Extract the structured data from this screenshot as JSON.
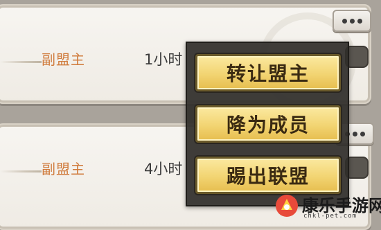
{
  "members": [
    {
      "role": "副盟主",
      "time": "1小时"
    },
    {
      "role": "副盟主",
      "time": "4小时"
    }
  ],
  "more_icon": "more-dots-icon",
  "menu": {
    "items": [
      {
        "label": "转让盟主"
      },
      {
        "label": "降为成员"
      },
      {
        "label": "踢出联盟"
      }
    ]
  },
  "watermark": {
    "name": "康乐手游网",
    "url": "chkl-pet.com"
  },
  "colors": {
    "role_text": "#d07b3c",
    "menu_button": "#f2d472",
    "menu_panel": "#302e2b"
  }
}
